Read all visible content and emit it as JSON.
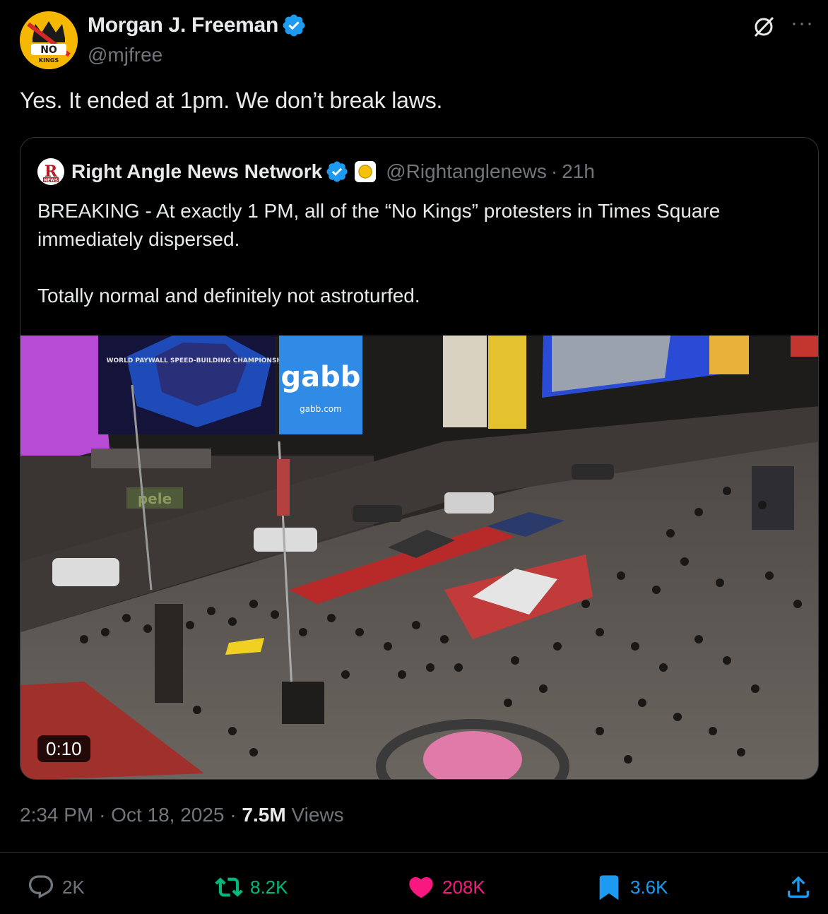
{
  "author": {
    "display_name": "Morgan J. Freeman",
    "handle": "@mjfree",
    "avatar_icon": "no-kings-crown-logo",
    "avatar_text_top": "NO",
    "avatar_text_bottom": "KINGS",
    "verified": true
  },
  "tweet": {
    "text": "Yes. It ended at 1pm. We don’t break laws."
  },
  "quoted": {
    "display_name": "Right Angle News Network",
    "handle": "@Rightanglenews",
    "separator": "·",
    "time": "21h",
    "verified": true,
    "avatar_text": "R",
    "avatar_subtext": "NEWS",
    "paragraph1": "BREAKING - At exactly 1 PM, all of the “No Kings” protesters in Times Square immediately dispersed.",
    "paragraph2": "Totally normal and definitely not astroturfed.",
    "video": {
      "duration": "0:10",
      "billboard_text": "gabb",
      "billboard_subtext": "gabb.com",
      "billboard_title": "WORLD PAYWALL SPEED-BUILDING CHAMPIONSHIPS",
      "store_sign": "pele"
    }
  },
  "meta": {
    "time": "2:34 PM",
    "sep1": "·",
    "date": "Oct 18, 2025",
    "sep2": "·",
    "views_count": "7.5M",
    "views_label": "Views"
  },
  "actions": {
    "replies": "2K",
    "retweets": "8.2K",
    "likes": "208K",
    "bookmarks": "3.6K"
  },
  "colors": {
    "background": "#000000",
    "text": "#e7e9ea",
    "muted": "#71767b",
    "verified": "#1d9bf0",
    "retweet": "#00ba7c",
    "like": "#f91880",
    "bookmark": "#1d9bf0",
    "border": "#333639"
  }
}
